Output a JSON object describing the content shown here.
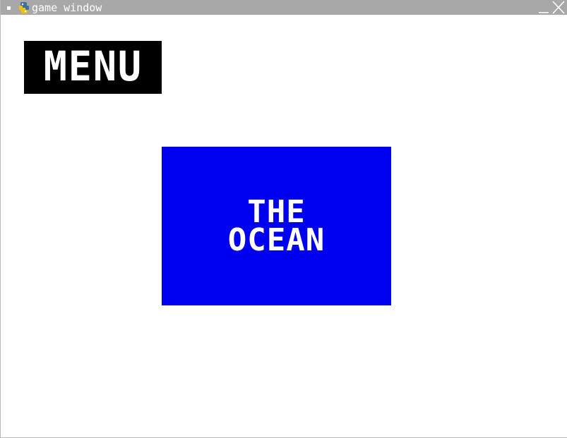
{
  "window": {
    "title": "game window",
    "titlebar_color": "#a8a8a8",
    "icons": {
      "system_menu": "square-dot-icon",
      "app": "python-snake-icon",
      "minimize": "minimize-icon",
      "close": "close-x-icon"
    }
  },
  "game": {
    "background_color": "#ffffff",
    "menu_button": {
      "label": "MENU",
      "background_color": "#000000",
      "text_color": "#ffffff"
    },
    "level_card": {
      "line1": "THE",
      "line2": "OCEAN",
      "background_color": "#0000f0",
      "text_color": "#ffffff"
    }
  }
}
